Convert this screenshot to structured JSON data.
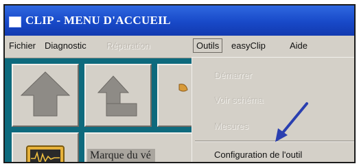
{
  "window": {
    "title": "CLIP - MENU D'ACCUEIL"
  },
  "menubar": {
    "items": [
      {
        "label": "Fichier",
        "enabled": true
      },
      {
        "label": "Diagnostic",
        "enabled": true
      },
      {
        "label": "Réparation",
        "enabled": false
      },
      {
        "label": "Outils",
        "enabled": true,
        "open": true
      },
      {
        "label": "easyClip",
        "enabled": true
      },
      {
        "label": "Aide",
        "enabled": true
      }
    ]
  },
  "outils_menu": {
    "items": [
      {
        "label": "Démarrer",
        "enabled": false
      },
      {
        "label": "Voir schéma",
        "enabled": false
      },
      {
        "label": "Mesures",
        "enabled": false
      },
      {
        "label": "Configuration de l'outil",
        "enabled": true
      }
    ]
  },
  "main": {
    "tiles": [
      {
        "icon": "home-arrow-icon"
      },
      {
        "icon": "up-arrow-icon"
      },
      {
        "icon": "tool-icon"
      },
      {
        "icon": "oscilloscope-icon"
      },
      {
        "label": "Marque du vé"
      }
    ]
  },
  "colors": {
    "titlebar": "#1849c8",
    "menubar": "#d4d0c8",
    "desktop": "#0e6a7d",
    "pointer_arrow": "#2a3fb0"
  }
}
